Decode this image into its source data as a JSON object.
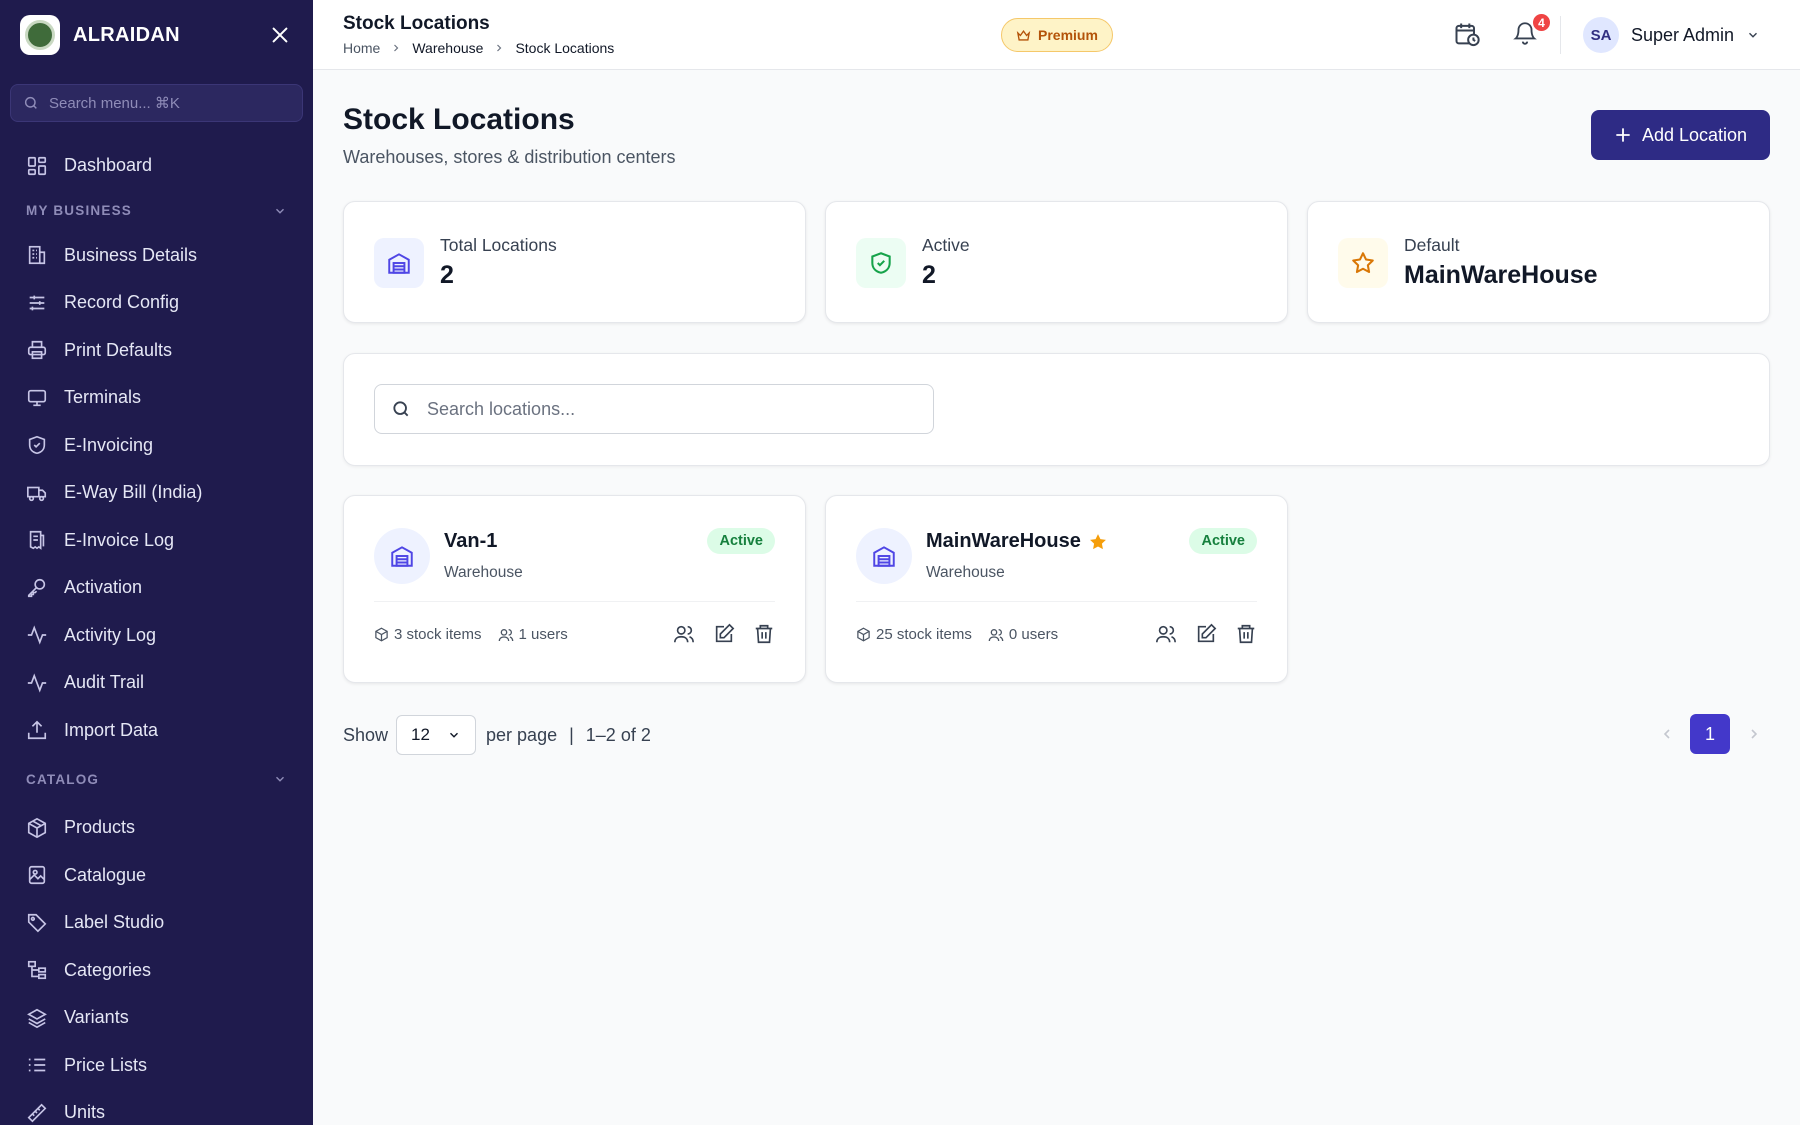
{
  "brand": {
    "name": "ALRAIDAN"
  },
  "sidebar": {
    "search_placeholder": "Search menu... ⌘K",
    "dashboard": "Dashboard",
    "sections": [
      {
        "title": "MY BUSINESS",
        "items": [
          {
            "label": "Business Details",
            "icon": "building-icon"
          },
          {
            "label": "Record Config",
            "icon": "sliders-icon"
          },
          {
            "label": "Print Defaults",
            "icon": "printer-icon"
          },
          {
            "label": "Terminals",
            "icon": "monitor-icon"
          },
          {
            "label": "E-Invoicing",
            "icon": "shield-icon"
          },
          {
            "label": "E-Way Bill (India)",
            "icon": "truck-icon"
          },
          {
            "label": "E-Invoice Log",
            "icon": "receipt-icon"
          },
          {
            "label": "Activation",
            "icon": "key-icon"
          },
          {
            "label": "Activity Log",
            "icon": "activity-icon"
          },
          {
            "label": "Audit Trail",
            "icon": "activity-icon"
          },
          {
            "label": "Import Data",
            "icon": "upload-icon"
          }
        ]
      },
      {
        "title": "CATALOG",
        "items": [
          {
            "label": "Products",
            "icon": "box-icon"
          },
          {
            "label": "Catalogue",
            "icon": "image-icon"
          },
          {
            "label": "Label Studio",
            "icon": "tag-icon"
          },
          {
            "label": "Categories",
            "icon": "tree-icon"
          },
          {
            "label": "Variants",
            "icon": "layers-icon"
          },
          {
            "label": "Price Lists",
            "icon": "list-icon"
          },
          {
            "label": "Units",
            "icon": "ruler-icon"
          }
        ]
      }
    ]
  },
  "header": {
    "title": "Stock Locations",
    "breadcrumb": [
      "Home",
      "Warehouse",
      "Stock Locations"
    ],
    "premium": "Premium",
    "notifications": "4",
    "user": {
      "initials": "SA",
      "name": "Super Admin"
    }
  },
  "page": {
    "title": "Stock Locations",
    "subtitle": "Warehouses, stores & distribution centers",
    "add_button": "Add Location"
  },
  "stats": [
    {
      "label": "Total Locations",
      "value": "2"
    },
    {
      "label": "Active",
      "value": "2"
    },
    {
      "label": "Default",
      "value": "MainWareHouse"
    }
  ],
  "search": {
    "placeholder": "Search locations..."
  },
  "locations": [
    {
      "name": "Van-1",
      "type": "Warehouse",
      "status": "Active",
      "stock": "3 stock items",
      "users": "1 users",
      "is_default": false
    },
    {
      "name": "MainWareHouse",
      "type": "Warehouse",
      "status": "Active",
      "stock": "25 stock items",
      "users": "0 users",
      "is_default": true
    }
  ],
  "pagination": {
    "show": "Show",
    "per_page_value": "12",
    "per_page": "per page",
    "separator": "|",
    "range": "1–2 of 2",
    "current_page": "1"
  },
  "colors": {
    "sidebar_bg": "#1f1b4d",
    "accent": "#2e2b85",
    "page_active": "#4338ca",
    "badge_green": "#15803d",
    "star": "#f59e0b"
  }
}
